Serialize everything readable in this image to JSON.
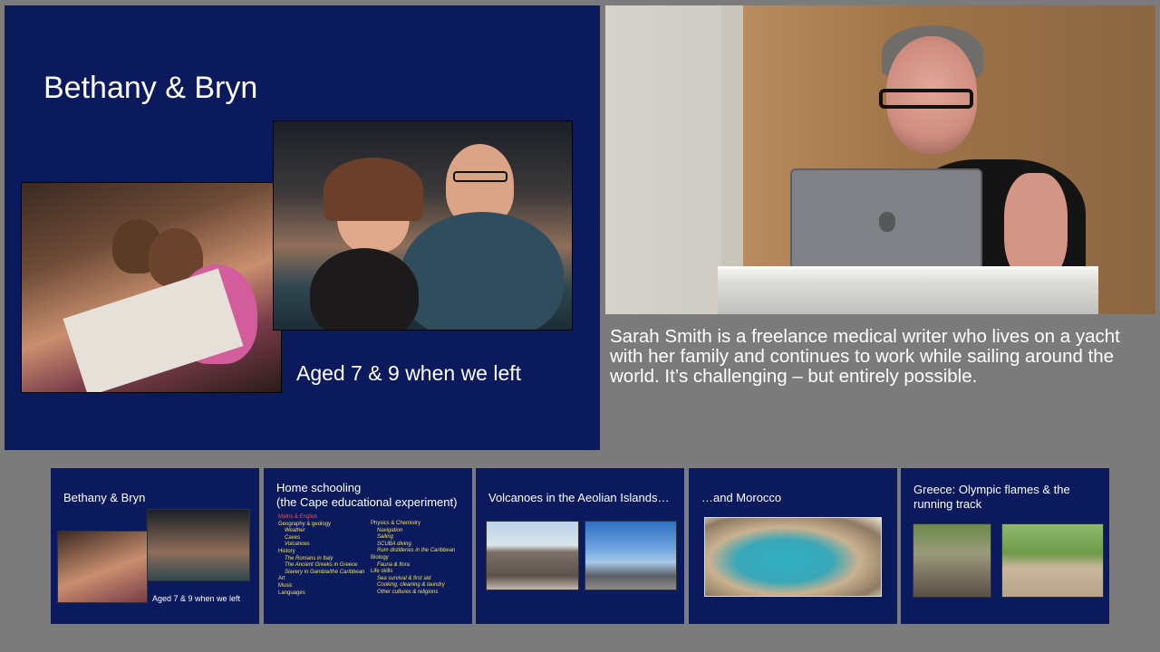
{
  "main_slide": {
    "title": "Bethany & Bryn",
    "caption": "Aged 7 & 9 when we left"
  },
  "speaker_description": "Sarah Smith is a freelance medical writer who lives on a yacht with her family and continues to work while sailing around the world. It’s challenging – but entirely possible.",
  "thumbnails": [
    {
      "title": "Bethany & Bryn",
      "caption": "Aged 7 & 9 when we left"
    },
    {
      "title": "Home schooling\n(the Cape educational experiment)",
      "col1": [
        {
          "text": "Maths & English",
          "style": "red"
        },
        {
          "text": "Geography & geology",
          "style": "main"
        },
        {
          "text": "Weather",
          "style": "sub"
        },
        {
          "text": "Caves",
          "style": "sub"
        },
        {
          "text": "Volcanoes",
          "style": "sub"
        },
        {
          "text": "History",
          "style": "main"
        },
        {
          "text": "The Romans in Italy",
          "style": "sub"
        },
        {
          "text": "The Ancient Greeks in Greece",
          "style": "sub"
        },
        {
          "text": "Slavery in Gambia/the Caribbean",
          "style": "sub"
        },
        {
          "text": "Art",
          "style": "main"
        },
        {
          "text": "Music",
          "style": "main"
        },
        {
          "text": "Languages",
          "style": "main"
        }
      ],
      "col2": [
        {
          "text": "Physics & Chemistry",
          "style": "main"
        },
        {
          "text": "Navigation",
          "style": "sub"
        },
        {
          "text": "Sailing",
          "style": "sub"
        },
        {
          "text": "SCUBA diving",
          "style": "sub"
        },
        {
          "text": "Rum distilleries in the Caribbean",
          "style": "sub"
        },
        {
          "text": "Biology",
          "style": "main"
        },
        {
          "text": "Fauna & flora",
          "style": "sub"
        },
        {
          "text": "Life skills",
          "style": "main"
        },
        {
          "text": "Sea survival & first aid",
          "style": "sub"
        },
        {
          "text": "Cooking, cleaning & laundry",
          "style": "sub"
        },
        {
          "text": "Other cultures & religions",
          "style": "sub"
        }
      ]
    },
    {
      "title": "Volcanoes in the Aeolian Islands…"
    },
    {
      "title": "…and Morocco"
    },
    {
      "title": "Greece: Olympic flames & the running track"
    }
  ]
}
